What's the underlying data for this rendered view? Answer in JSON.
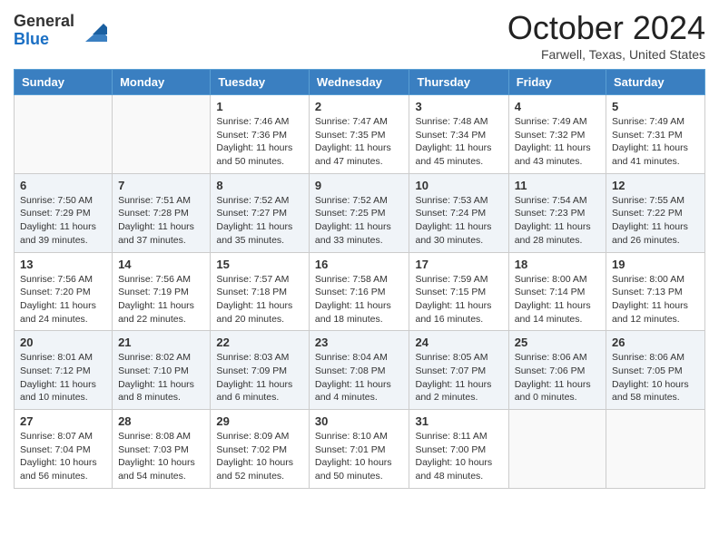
{
  "logo": {
    "general": "General",
    "blue": "Blue"
  },
  "title": "October 2024",
  "location": "Farwell, Texas, United States",
  "days_of_week": [
    "Sunday",
    "Monday",
    "Tuesday",
    "Wednesday",
    "Thursday",
    "Friday",
    "Saturday"
  ],
  "weeks": [
    [
      {
        "day": "",
        "info": ""
      },
      {
        "day": "",
        "info": ""
      },
      {
        "day": "1",
        "info": "Sunrise: 7:46 AM\nSunset: 7:36 PM\nDaylight: 11 hours and 50 minutes."
      },
      {
        "day": "2",
        "info": "Sunrise: 7:47 AM\nSunset: 7:35 PM\nDaylight: 11 hours and 47 minutes."
      },
      {
        "day": "3",
        "info": "Sunrise: 7:48 AM\nSunset: 7:34 PM\nDaylight: 11 hours and 45 minutes."
      },
      {
        "day": "4",
        "info": "Sunrise: 7:49 AM\nSunset: 7:32 PM\nDaylight: 11 hours and 43 minutes."
      },
      {
        "day": "5",
        "info": "Sunrise: 7:49 AM\nSunset: 7:31 PM\nDaylight: 11 hours and 41 minutes."
      }
    ],
    [
      {
        "day": "6",
        "info": "Sunrise: 7:50 AM\nSunset: 7:29 PM\nDaylight: 11 hours and 39 minutes."
      },
      {
        "day": "7",
        "info": "Sunrise: 7:51 AM\nSunset: 7:28 PM\nDaylight: 11 hours and 37 minutes."
      },
      {
        "day": "8",
        "info": "Sunrise: 7:52 AM\nSunset: 7:27 PM\nDaylight: 11 hours and 35 minutes."
      },
      {
        "day": "9",
        "info": "Sunrise: 7:52 AM\nSunset: 7:25 PM\nDaylight: 11 hours and 33 minutes."
      },
      {
        "day": "10",
        "info": "Sunrise: 7:53 AM\nSunset: 7:24 PM\nDaylight: 11 hours and 30 minutes."
      },
      {
        "day": "11",
        "info": "Sunrise: 7:54 AM\nSunset: 7:23 PM\nDaylight: 11 hours and 28 minutes."
      },
      {
        "day": "12",
        "info": "Sunrise: 7:55 AM\nSunset: 7:22 PM\nDaylight: 11 hours and 26 minutes."
      }
    ],
    [
      {
        "day": "13",
        "info": "Sunrise: 7:56 AM\nSunset: 7:20 PM\nDaylight: 11 hours and 24 minutes."
      },
      {
        "day": "14",
        "info": "Sunrise: 7:56 AM\nSunset: 7:19 PM\nDaylight: 11 hours and 22 minutes."
      },
      {
        "day": "15",
        "info": "Sunrise: 7:57 AM\nSunset: 7:18 PM\nDaylight: 11 hours and 20 minutes."
      },
      {
        "day": "16",
        "info": "Sunrise: 7:58 AM\nSunset: 7:16 PM\nDaylight: 11 hours and 18 minutes."
      },
      {
        "day": "17",
        "info": "Sunrise: 7:59 AM\nSunset: 7:15 PM\nDaylight: 11 hours and 16 minutes."
      },
      {
        "day": "18",
        "info": "Sunrise: 8:00 AM\nSunset: 7:14 PM\nDaylight: 11 hours and 14 minutes."
      },
      {
        "day": "19",
        "info": "Sunrise: 8:00 AM\nSunset: 7:13 PM\nDaylight: 11 hours and 12 minutes."
      }
    ],
    [
      {
        "day": "20",
        "info": "Sunrise: 8:01 AM\nSunset: 7:12 PM\nDaylight: 11 hours and 10 minutes."
      },
      {
        "day": "21",
        "info": "Sunrise: 8:02 AM\nSunset: 7:10 PM\nDaylight: 11 hours and 8 minutes."
      },
      {
        "day": "22",
        "info": "Sunrise: 8:03 AM\nSunset: 7:09 PM\nDaylight: 11 hours and 6 minutes."
      },
      {
        "day": "23",
        "info": "Sunrise: 8:04 AM\nSunset: 7:08 PM\nDaylight: 11 hours and 4 minutes."
      },
      {
        "day": "24",
        "info": "Sunrise: 8:05 AM\nSunset: 7:07 PM\nDaylight: 11 hours and 2 minutes."
      },
      {
        "day": "25",
        "info": "Sunrise: 8:06 AM\nSunset: 7:06 PM\nDaylight: 11 hours and 0 minutes."
      },
      {
        "day": "26",
        "info": "Sunrise: 8:06 AM\nSunset: 7:05 PM\nDaylight: 10 hours and 58 minutes."
      }
    ],
    [
      {
        "day": "27",
        "info": "Sunrise: 8:07 AM\nSunset: 7:04 PM\nDaylight: 10 hours and 56 minutes."
      },
      {
        "day": "28",
        "info": "Sunrise: 8:08 AM\nSunset: 7:03 PM\nDaylight: 10 hours and 54 minutes."
      },
      {
        "day": "29",
        "info": "Sunrise: 8:09 AM\nSunset: 7:02 PM\nDaylight: 10 hours and 52 minutes."
      },
      {
        "day": "30",
        "info": "Sunrise: 8:10 AM\nSunset: 7:01 PM\nDaylight: 10 hours and 50 minutes."
      },
      {
        "day": "31",
        "info": "Sunrise: 8:11 AM\nSunset: 7:00 PM\nDaylight: 10 hours and 48 minutes."
      },
      {
        "day": "",
        "info": ""
      },
      {
        "day": "",
        "info": ""
      }
    ]
  ]
}
